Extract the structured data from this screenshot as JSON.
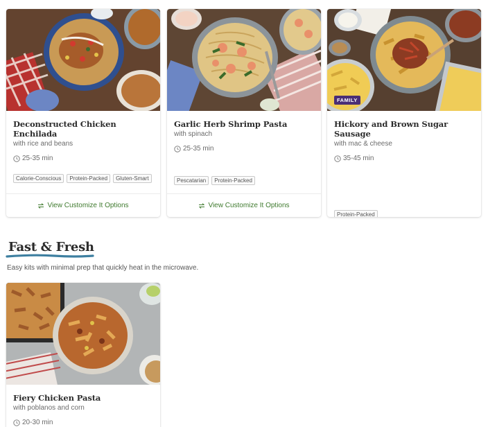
{
  "cards": [
    {
      "title": "Deconstructed Chicken Enchilada",
      "subtitle": "with rice and beans",
      "time": "25-35 min",
      "tags": [
        "Calorie-Conscious",
        "Protein-Packed",
        "Gluten-Smart"
      ],
      "footer": "View Customize It Options"
    },
    {
      "title": "Garlic Herb Shrimp Pasta",
      "subtitle": "with spinach",
      "time": "25-35 min",
      "tags": [
        "Pescatarian",
        "Protein-Packed"
      ],
      "footer": "View Customize It Options"
    },
    {
      "title": "Hickory and Brown Sugar Sausage",
      "subtitle": "with mac & cheese",
      "time": "35-45 min",
      "badge": "FAMILY",
      "tags": [
        "Protein-Packed"
      ]
    }
  ],
  "section": {
    "title": "Fast & Fresh",
    "description": "Easy kits with minimal prep that quickly heat in the microwave.",
    "accent_color": "#3d7fa0"
  },
  "fast_cards": [
    {
      "title": "Fiery Chicken Pasta",
      "subtitle": "with poblanos and corn",
      "time": "20-30 min"
    }
  ],
  "colors": {
    "link_green": "#3f7a2e",
    "badge_purple": "#4a2e76"
  },
  "icons": {
    "clock": "clock-icon",
    "swap": "swap-arrows-icon"
  }
}
